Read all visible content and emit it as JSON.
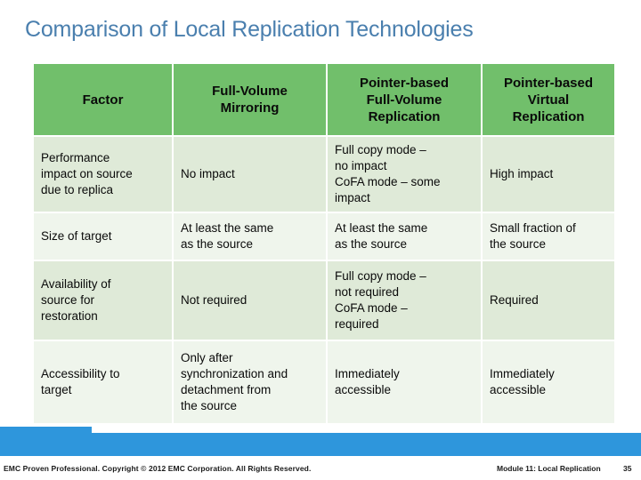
{
  "slide": {
    "title": "Comparison of Local Replication Technologies",
    "title_color": "#4a7fae"
  },
  "table": {
    "header_bg": "#71bf6b",
    "row_bg": "#dfead8",
    "row_alt_bg": "#eff5ec",
    "columns": [
      {
        "key": "factor",
        "label": "Factor"
      },
      {
        "key": "fvm",
        "label_lines": [
          "Full-Volume",
          "Mirroring"
        ]
      },
      {
        "key": "pbfvr",
        "label_lines": [
          "Pointer-based",
          "Full-Volume",
          "Replication"
        ]
      },
      {
        "key": "pbvr",
        "label_lines": [
          "Pointer-based",
          "Virtual",
          "Replication"
        ]
      }
    ],
    "headers": {
      "factor": "Factor",
      "fvm_line1": "Full-Volume",
      "fvm_line2": "Mirroring",
      "pbfvr_line1": "Pointer-based",
      "pbfvr_line2": "Full-Volume",
      "pbfvr_line3": "Replication",
      "pbvr_line1": "Pointer-based",
      "pbvr_line2": "Virtual",
      "pbvr_line3": "Replication"
    },
    "rows": [
      {
        "factor_line1": "Performance",
        "factor_line2": "impact on source",
        "factor_line3": "due to replica",
        "fvm": "No impact",
        "pbfvr_line1": "Full copy mode –",
        "pbfvr_line2": "no impact",
        "pbfvr_line3": "CoFA mode – some",
        "pbfvr_line4": "impact",
        "pbvr": "High impact"
      },
      {
        "factor": "Size of target",
        "fvm_line1": "At least the same",
        "fvm_line2": "as the source",
        "pbfvr_line1": "At least the same",
        "pbfvr_line2": "as the source",
        "pbvr_line1": "Small fraction of",
        "pbvr_line2": "the source"
      },
      {
        "factor_line1": "Availability of",
        "factor_line2": "source for",
        "factor_line3": "restoration",
        "fvm": "Not required",
        "pbfvr_line1": "Full copy mode –",
        "pbfvr_line2": "not required",
        "pbfvr_line3": "CoFA mode –",
        "pbfvr_line4": "required",
        "pbvr": "Required"
      },
      {
        "factor_line1": "Accessibility to",
        "factor_line2": "target",
        "fvm_line1": "Only after",
        "fvm_line2": "synchronization and",
        "fvm_line3": "detachment from",
        "fvm_line4": "the source",
        "pbfvr_line1": "Immediately",
        "pbfvr_line2": "accessible",
        "pbvr_line1": "Immediately",
        "pbvr_line2": "accessible"
      }
    ]
  },
  "footer": {
    "bar_color": "#2e96dc",
    "copyright": "EMC Proven Professional. Copyright © 2012 EMC Corporation. All Rights Reserved.",
    "module": "Module 11: Local Replication",
    "slide_number": "35"
  }
}
